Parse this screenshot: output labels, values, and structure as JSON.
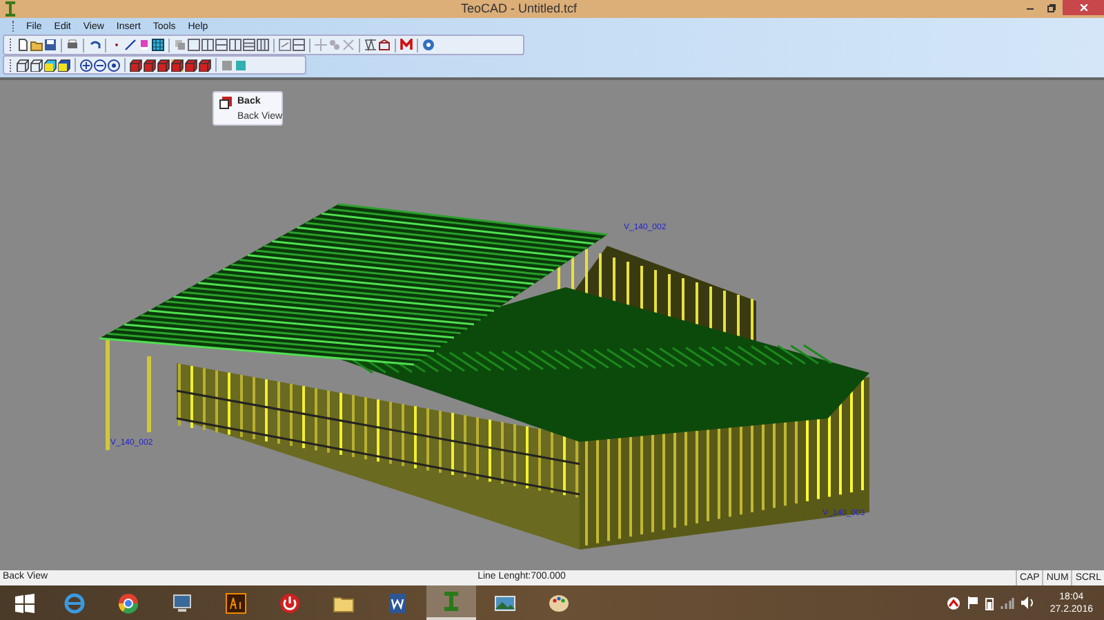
{
  "window": {
    "title": "TeoCAD - Untitled.tcf"
  },
  "menu": [
    "File",
    "Edit",
    "View",
    "Insert",
    "Tools",
    "Help"
  ],
  "tooltip": {
    "title": "Back",
    "description": "Back View"
  },
  "model_labels": [
    {
      "text": "V_140_002",
      "kind": "left"
    },
    {
      "text": "V_140_002",
      "kind": "back"
    },
    {
      "text": "V_140_003",
      "kind": "right"
    }
  ],
  "status_bar": {
    "message": "Back View",
    "line_length": "Line Lenght:700.000",
    "indicators": [
      "CAP",
      "NUM",
      "SCRL"
    ]
  },
  "taskbar": {
    "apps": [
      {
        "kind": "ie",
        "selected": false
      },
      {
        "kind": "chrome",
        "selected": false
      },
      {
        "kind": "remote",
        "selected": false
      },
      {
        "kind": "illustrator",
        "selected": false
      },
      {
        "kind": "power",
        "selected": false
      },
      {
        "kind": "folder",
        "selected": false
      },
      {
        "kind": "word",
        "selected": false
      },
      {
        "kind": "teocad",
        "selected": true
      },
      {
        "kind": "photos",
        "selected": false
      },
      {
        "kind": "paint",
        "selected": false
      }
    ],
    "time": "18:04",
    "date": "27.2.2016"
  }
}
